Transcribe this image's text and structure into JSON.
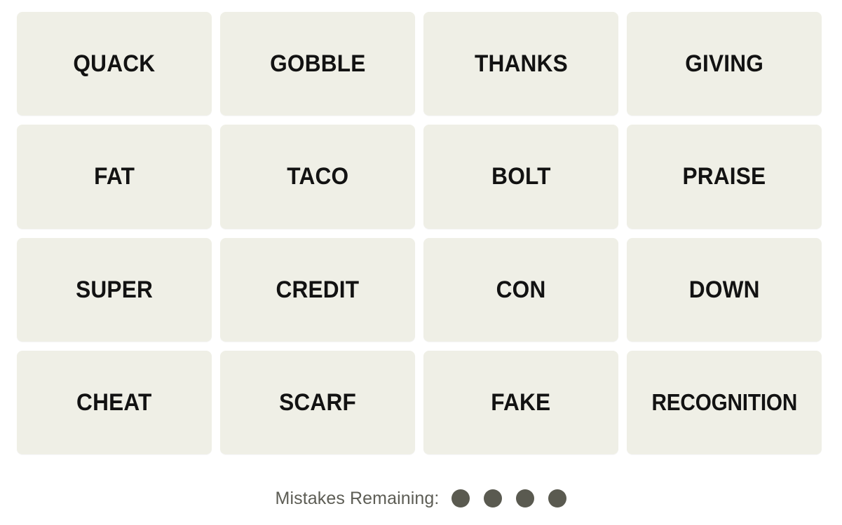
{
  "app": {
    "name": "Connections",
    "background_color": "#ffffff"
  },
  "board": {
    "rows": 4,
    "columns": 4,
    "tile_color": "#efefe6",
    "tile_text_color": "#121212",
    "tiles": [
      {
        "label": "QUACK"
      },
      {
        "label": "GOBBLE"
      },
      {
        "label": "THANKS"
      },
      {
        "label": "GIVING"
      },
      {
        "label": "FAT"
      },
      {
        "label": "TACO"
      },
      {
        "label": "BOLT"
      },
      {
        "label": "PRAISE"
      },
      {
        "label": "SUPER"
      },
      {
        "label": "CREDIT"
      },
      {
        "label": "CON"
      },
      {
        "label": "DOWN"
      },
      {
        "label": "CHEAT"
      },
      {
        "label": "SCARF"
      },
      {
        "label": "FAKE"
      },
      {
        "label": "RECOGNITION"
      }
    ]
  },
  "mistakes": {
    "label": "Mistakes Remaining:",
    "remaining": 4,
    "dot_color": "#5a5a50",
    "label_color": "#5d5d55"
  }
}
